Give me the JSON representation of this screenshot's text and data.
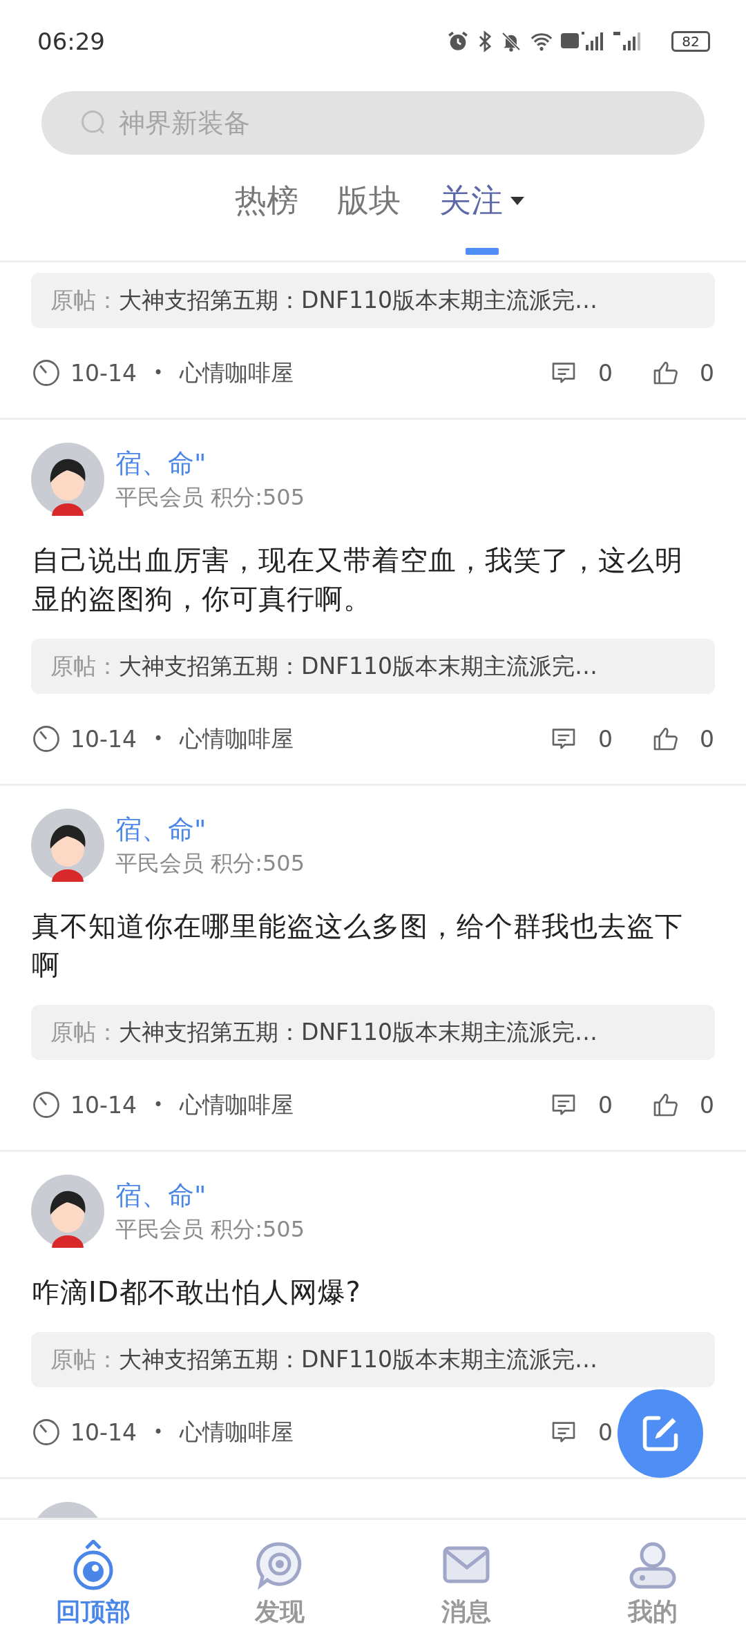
{
  "status_bar": {
    "time": "06:29",
    "battery": "82"
  },
  "search": {
    "placeholder": "神界新装备"
  },
  "tabs": [
    {
      "label": "热榜",
      "selected": false,
      "dropdown": false
    },
    {
      "label": "版块",
      "selected": false,
      "dropdown": false
    },
    {
      "label": "关注",
      "selected": true,
      "dropdown": true
    }
  ],
  "posts": [
    {
      "original_post": {
        "label": "原帖：",
        "title": "大神支招第五期：DNF110版本末期主流派完…"
      },
      "date": "10-14",
      "separator": "•",
      "board": "心情咖啡屋",
      "comments": "0",
      "likes": "0"
    },
    {
      "author": {
        "name": "宿、命\"",
        "rank": "平民会员 积分:505"
      },
      "content": "自己说出血厉害，现在又带着空血，我笑了，这么明显的盗图狗，你可真行啊。",
      "original_post": {
        "label": "原帖：",
        "title": "大神支招第五期：DNF110版本末期主流派完…"
      },
      "date": "10-14",
      "separator": "•",
      "board": "心情咖啡屋",
      "comments": "0",
      "likes": "0"
    },
    {
      "author": {
        "name": "宿、命\"",
        "rank": "平民会员 积分:505"
      },
      "content": "真不知道你在哪里能盗这么多图，给个群我也去盗下啊",
      "original_post": {
        "label": "原帖：",
        "title": "大神支招第五期：DNF110版本末期主流派完…"
      },
      "date": "10-14",
      "separator": "•",
      "board": "心情咖啡屋",
      "comments": "0",
      "likes": "0"
    },
    {
      "author": {
        "name": "宿、命\"",
        "rank": "平民会员 积分:505"
      },
      "content": "咋滴ID都不敢出怕人网爆?",
      "original_post": {
        "label": "原帖：",
        "title": "大神支招第五期：DNF110版本末期主流派完…"
      },
      "date": "10-14",
      "separator": "•",
      "board": "心情咖啡屋",
      "comments": "0"
    },
    {
      "author": {
        "avatar": true
      }
    }
  ],
  "bottom_nav": [
    {
      "label": "回顶部",
      "selected": true,
      "kind": "top"
    },
    {
      "label": "发现",
      "selected": false,
      "kind": "discover"
    },
    {
      "label": "消息",
      "selected": false,
      "kind": "message"
    },
    {
      "label": "我的",
      "selected": false,
      "kind": "profile"
    }
  ]
}
